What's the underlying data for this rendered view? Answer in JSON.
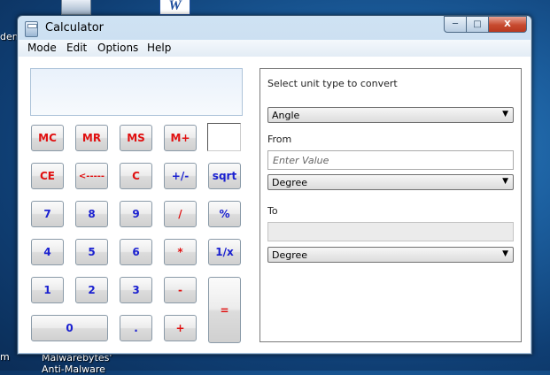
{
  "desktop": {
    "left_text_top": "dent",
    "left_text_bottom": "m",
    "icon_label_line1": "Malwarebytes'",
    "icon_label_line2": "Anti-Malware"
  },
  "window": {
    "title": "Calculator",
    "controls": {
      "minimize": "─",
      "maximize": "□",
      "close": "X"
    }
  },
  "menu": [
    "Mode",
    "Edit",
    "Options",
    "Help"
  ],
  "calculator": {
    "display_value": "",
    "buttons": {
      "mc": "MC",
      "mr": "MR",
      "ms": "MS",
      "mplus": "M+",
      "ce": "CE",
      "back": "<-----",
      "c": "C",
      "plusminus": "+/-",
      "sqrt": "sqrt",
      "d7": "7",
      "d8": "8",
      "d9": "9",
      "div": "/",
      "pct": "%",
      "d4": "4",
      "d5": "5",
      "d6": "6",
      "mul": "*",
      "inv": "1/x",
      "d1": "1",
      "d2": "2",
      "d3": "3",
      "sub": "-",
      "eq": "=",
      "d0": "0",
      "dot": ".",
      "add": "+"
    }
  },
  "converter": {
    "heading": "Select unit type to convert",
    "unit_type": "Angle",
    "from_label": "From",
    "from_placeholder": "Enter Value",
    "from_unit": "Degree",
    "to_label": "To",
    "to_value": "",
    "to_unit": "Degree"
  },
  "colors": {
    "red_keys": "#e01010",
    "blue_keys": "#1a20d0"
  }
}
